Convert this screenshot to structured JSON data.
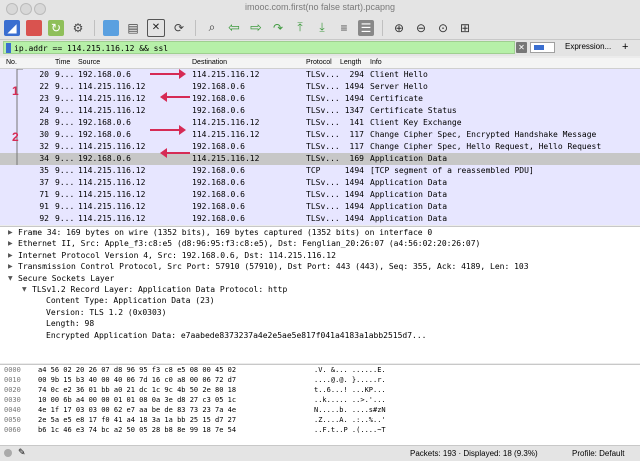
{
  "window": {
    "title": "imooc.com.first(no false start).pcapng"
  },
  "toolbar": {
    "icons": [
      "shark-fin-icon",
      "stop-icon",
      "restart-icon",
      "options-gear-icon",
      "open-folder-icon",
      "save-file-icon",
      "close-file-icon",
      "reload-icon",
      "find-icon",
      "back-arrow-icon",
      "forward-arrow-icon",
      "goto-packet-icon",
      "first-packet-icon",
      "last-packet-icon",
      "autoscroll-icon",
      "colorize-icon",
      "zoom-in-icon",
      "zoom-out-icon",
      "zoom-reset-icon",
      "resize-columns-icon"
    ]
  },
  "filter": {
    "value": "ip.addr == 114.215.116.12 && ssl",
    "expression_label": "Expression...",
    "plus_label": "+"
  },
  "packet_list": {
    "columns": [
      "No.",
      "Time",
      "Source",
      "Destination",
      "Protocol",
      "Length",
      "Info"
    ],
    "rows": [
      {
        "no": "20",
        "time": "9...",
        "src": "192.168.0.6",
        "dst": "114.215.116.12",
        "proto": "TLSv...",
        "len": "294",
        "info": "Client Hello",
        "bg": "#e7e6ff",
        "fg": "#000000"
      },
      {
        "no": "22",
        "time": "9...",
        "src": "114.215.116.12",
        "dst": "192.168.0.6",
        "proto": "TLSv...",
        "len": "1494",
        "info": "Server Hello",
        "bg": "#e7e6ff",
        "fg": "#000000"
      },
      {
        "no": "23",
        "time": "9...",
        "src": "114.215.116.12",
        "dst": "192.168.0.6",
        "proto": "TLSv...",
        "len": "1494",
        "info": "Certificate",
        "bg": "#e7e6ff",
        "fg": "#000000"
      },
      {
        "no": "24",
        "time": "9...",
        "src": "114.215.116.12",
        "dst": "192.168.0.6",
        "proto": "TLSv...",
        "len": "1347",
        "info": "Certificate Status",
        "bg": "#e7e6ff",
        "fg": "#000000"
      },
      {
        "no": "28",
        "time": "9...",
        "src": "192.168.0.6",
        "dst": "114.215.116.12",
        "proto": "TLSv...",
        "len": "141",
        "info": "Client Key Exchange",
        "bg": "#e7e6ff",
        "fg": "#000000"
      },
      {
        "no": "30",
        "time": "9...",
        "src": "192.168.0.6",
        "dst": "114.215.116.12",
        "proto": "TLSv...",
        "len": "117",
        "info": "Change Cipher Spec, Encrypted Handshake Message",
        "bg": "#e7e6ff",
        "fg": "#000000"
      },
      {
        "no": "32",
        "time": "9...",
        "src": "114.215.116.12",
        "dst": "192.168.0.6",
        "proto": "TLSv...",
        "len": "117",
        "info": "Change Cipher Spec, Hello Request, Hello Request",
        "bg": "#e7e6ff",
        "fg": "#000000"
      },
      {
        "no": "34",
        "time": "9...",
        "src": "192.168.0.6",
        "dst": "114.215.116.12",
        "proto": "TLSv...",
        "len": "169",
        "info": "Application Data",
        "bg": "#c7c7c7",
        "fg": "#000000"
      },
      {
        "no": "35",
        "time": "9...",
        "src": "114.215.116.12",
        "dst": "192.168.0.6",
        "proto": "TCP",
        "len": "1494",
        "info": "[TCP segment of a reassembled PDU]",
        "bg": "#e7e6ff",
        "fg": "#000000"
      },
      {
        "no": "37",
        "time": "9...",
        "src": "114.215.116.12",
        "dst": "192.168.0.6",
        "proto": "TLSv...",
        "len": "1494",
        "info": "Application Data",
        "bg": "#e7e6ff",
        "fg": "#000000"
      },
      {
        "no": "71",
        "time": "9...",
        "src": "114.215.116.12",
        "dst": "192.168.0.6",
        "proto": "TLSv...",
        "len": "1494",
        "info": "Application Data",
        "bg": "#e7e6ff",
        "fg": "#000000"
      },
      {
        "no": "91",
        "time": "9...",
        "src": "114.215.116.12",
        "dst": "192.168.0.6",
        "proto": "TLSv...",
        "len": "1494",
        "info": "Application Data",
        "bg": "#e7e6ff",
        "fg": "#000000"
      },
      {
        "no": "92",
        "time": "9...",
        "src": "114.215.116.12",
        "dst": "192.168.0.6",
        "proto": "TLSv...",
        "len": "1494",
        "info": "Application Data",
        "bg": "#e7e6ff",
        "fg": "#000000"
      },
      {
        "no": "136",
        "time": "9...",
        "src": "114.215.116.12",
        "dst": "192.168.0.6",
        "proto": "TLSv...",
        "len": "1494",
        "info": "Application Data",
        "bg": "#e7e6ff",
        "fg": "#000000"
      }
    ]
  },
  "annotations": {
    "label_1": "1",
    "label_2": "2",
    "color": "#d62b55"
  },
  "details": [
    {
      "text": "Frame 34: 169 bytes on wire (1352 bits), 169 bytes captured (1352 bits) on interface 0",
      "indent": 0,
      "tri": "right"
    },
    {
      "text": "Ethernet II, Src: Apple_f3:c8:e5 (d8:96:95:f3:c8:e5), Dst: Fenglian_20:26:07 (a4:56:02:20:26:07)",
      "indent": 0,
      "tri": "right"
    },
    {
      "text": "Internet Protocol Version 4, Src: 192.168.0.6, Dst: 114.215.116.12",
      "indent": 0,
      "tri": "right"
    },
    {
      "text": "Transmission Control Protocol, Src Port: 57910 (57910), Dst Port: 443 (443), Seq: 355, Ack: 4189, Len: 103",
      "indent": 0,
      "tri": "right"
    },
    {
      "text": "Secure Sockets Layer",
      "indent": 0,
      "tri": "down"
    },
    {
      "text": "TLSv1.2 Record Layer: Application Data Protocol: http",
      "indent": 1,
      "tri": "down"
    },
    {
      "text": "Content Type: Application Data (23)",
      "indent": 2,
      "tri": ""
    },
    {
      "text": "Version: TLS 1.2 (0x0303)",
      "indent": 2,
      "tri": ""
    },
    {
      "text": "Length: 98",
      "indent": 2,
      "tri": ""
    },
    {
      "text": "Encrypted Application Data: e7aabede8373237a4e2e5ae5e817f041a4183a1abb2515d7...",
      "indent": 2,
      "tri": ""
    }
  ],
  "hex": [
    {
      "offset": "0000",
      "bytes": "a4 56 02 20 26 07 d8 96  95 f3 c8 e5 08 00 45 02",
      "ascii": ".V. &... ......E."
    },
    {
      "offset": "0010",
      "bytes": "00 9b 15 b3 40 00 40 06  7d 16 c0 a8 00 06 72 d7",
      "ascii": "....@.@. }.....r."
    },
    {
      "offset": "0020",
      "bytes": "74 0c e2 36 01 bb a0 21  dc 1c 9c 4b 50 2e 80 18",
      "ascii": "t..6...! ...KP..."
    },
    {
      "offset": "0030",
      "bytes": "10 00 6b a4 00 00 01 01  08 0a 3e d8 27 c3 05 1c",
      "ascii": "..k..... ..>.'..."
    },
    {
      "offset": "0040",
      "bytes": "4e 1f 17 03 03 00 62 e7  aa be de 83 73 23 7a 4e",
      "ascii": "N.....b. ....s#zN"
    },
    {
      "offset": "0050",
      "bytes": "2e 5a e5 e8 17 f0 41 a4  18 3a 1a bb 25 15 d7 27",
      "ascii": ".Z....A. .:..%..'"
    },
    {
      "offset": "0060",
      "bytes": "b6 1c 46 e3 74 bc a2 50  05 28 b8 8e 99 18 7e 54",
      "ascii": "..F.t..P .(....~T"
    }
  ],
  "status": {
    "packets": "Packets: 193 · Displayed: 18 (9.3%)",
    "profile": "Profile: Default"
  }
}
